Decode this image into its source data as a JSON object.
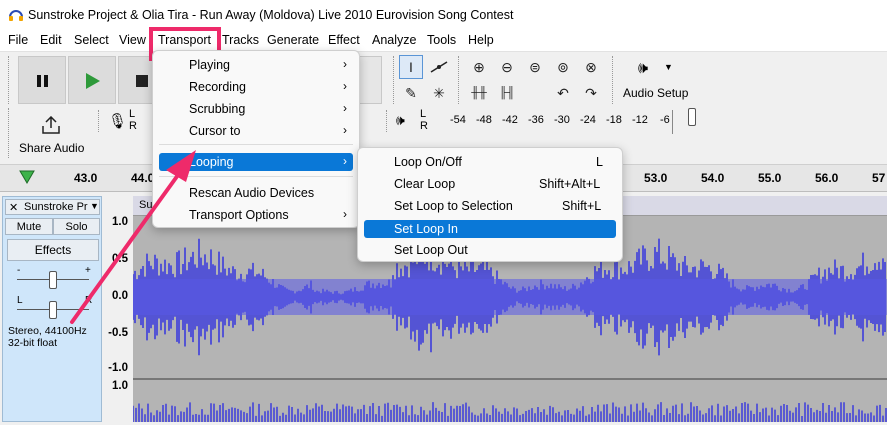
{
  "window": {
    "title": "Sunstroke Project & Olia Tira - Run Away (Moldova) Live 2010 Eurovision Song Contest"
  },
  "menubar": [
    "File",
    "Edit",
    "Select",
    "View",
    "Transport",
    "Tracks",
    "Generate",
    "Effect",
    "Analyze",
    "Tools",
    "Help"
  ],
  "toolbar": {
    "audio_setup_label": "Audio Setup",
    "share_audio_label": "Share Audio",
    "meter_L": "L",
    "meter_R": "R",
    "playback_meter_ticks": [
      "-54",
      "-48",
      "-42",
      "-36",
      "-30",
      "-24",
      "-18",
      "-12",
      "-6"
    ]
  },
  "ruler": {
    "labels": [
      "43.0",
      "44.0",
      "53.0",
      "54.0",
      "55.0",
      "56.0",
      "57"
    ]
  },
  "track": {
    "name": "Sunstroke Pr",
    "mute": "Mute",
    "solo": "Solo",
    "effects": "Effects",
    "gain_minus": "-",
    "gain_plus": "+",
    "pan_L": "L",
    "pan_R": "R",
    "info_line1": "Stereo, 44100Hz",
    "info_line2": "32-bit float",
    "clip_name": "Su",
    "close_glyph": "✕"
  },
  "vertical_ruler": [
    "1.0",
    "0.5",
    "0.0",
    "-0.5",
    "-1.0",
    "1.0"
  ],
  "transport_menu": {
    "items": [
      {
        "label": "Playing",
        "submenu": true
      },
      {
        "label": "Recording",
        "submenu": true
      },
      {
        "label": "Scrubbing",
        "submenu": true
      },
      {
        "label": "Cursor to",
        "submenu": true
      },
      {
        "label": "Looping",
        "submenu": true,
        "highlighted": true
      },
      {
        "label": "Rescan Audio Devices",
        "submenu": false
      },
      {
        "label": "Transport Options",
        "submenu": true
      }
    ]
  },
  "looping_menu": {
    "items": [
      {
        "label": "Loop On/Off",
        "shortcut": "L"
      },
      {
        "label": "Clear Loop",
        "shortcut": "Shift+Alt+L"
      },
      {
        "label": "Set Loop to Selection",
        "shortcut": "Shift+L"
      },
      {
        "label": "Set Loop In",
        "shortcut": "",
        "highlighted": true
      },
      {
        "label": "Set Loop Out",
        "shortcut": ""
      }
    ]
  },
  "colors": {
    "accent_highlight": "#0a78d7",
    "annotation": "#ee2a6a",
    "waveform": "#3c3cdc",
    "waveform_bg": "#b4b4b4",
    "play_green": "#2e9a3a"
  },
  "icons": [
    "audacity-logo-icon",
    "pause-icon",
    "play-icon",
    "stop-icon",
    "selection-tool-icon",
    "envelope-tool-icon",
    "draw-tool-icon",
    "multi-tool-icon",
    "zoom-in-icon",
    "zoom-out-icon",
    "fit-selection-icon",
    "fit-project-icon",
    "zoom-toggle-icon",
    "trim-icon",
    "silence-icon",
    "undo-icon",
    "redo-icon",
    "speaker-icon",
    "microphone-icon",
    "share-icon",
    "play-head-icon",
    "chevron-right-icon"
  ]
}
